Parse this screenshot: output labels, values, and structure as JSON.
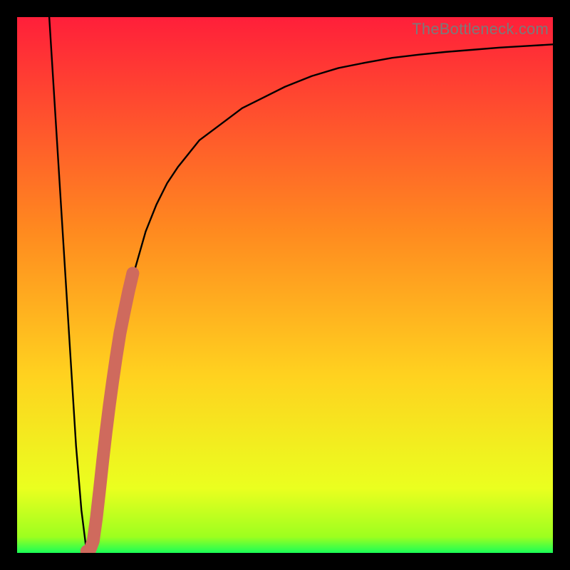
{
  "watermark": "TheBottleneck.com",
  "colors": {
    "curve": "#000000",
    "marker": "#cf6a5d",
    "gradient_top": "#ff1f3a",
    "gradient_mid1": "#ff7a1f",
    "gradient_mid2": "#ffd21f",
    "gradient_mid3": "#f3ff1f",
    "gradient_bottom": "#19ff57",
    "frame": "#000000"
  },
  "chart_data": {
    "type": "line",
    "title": "",
    "xlabel": "",
    "ylabel": "",
    "xlim": [
      0,
      100
    ],
    "ylim": [
      0,
      100
    ],
    "series": [
      {
        "name": "bottleneck-curve",
        "x": [
          6,
          7,
          8,
          9,
          10,
          11,
          12,
          13,
          14,
          15,
          16,
          18,
          20,
          22,
          24,
          26,
          28,
          30,
          34,
          38,
          42,
          46,
          50,
          55,
          60,
          65,
          70,
          75,
          80,
          85,
          90,
          95,
          100
        ],
        "values": [
          100,
          84,
          68,
          52,
          36,
          20,
          8,
          0,
          2,
          10,
          18,
          32,
          44,
          53,
          60,
          65,
          69,
          72,
          77,
          80,
          83,
          85,
          87,
          89,
          90.5,
          91.5,
          92.4,
          93,
          93.5,
          93.9,
          94.3,
          94.6,
          94.9
        ]
      }
    ],
    "markers": [
      {
        "name": "highlight-segment",
        "x": [
          13.0,
          13.6,
          14.2,
          14.8,
          15.4,
          16.0,
          16.6,
          17.2,
          17.8,
          18.5,
          19.2,
          20.0,
          20.8,
          21.6
        ],
        "values": [
          0.3,
          0.6,
          2.2,
          6.5,
          11.8,
          17.4,
          22.6,
          27.4,
          31.8,
          36.6,
          41.0,
          45.0,
          48.8,
          52.2
        ]
      }
    ]
  }
}
